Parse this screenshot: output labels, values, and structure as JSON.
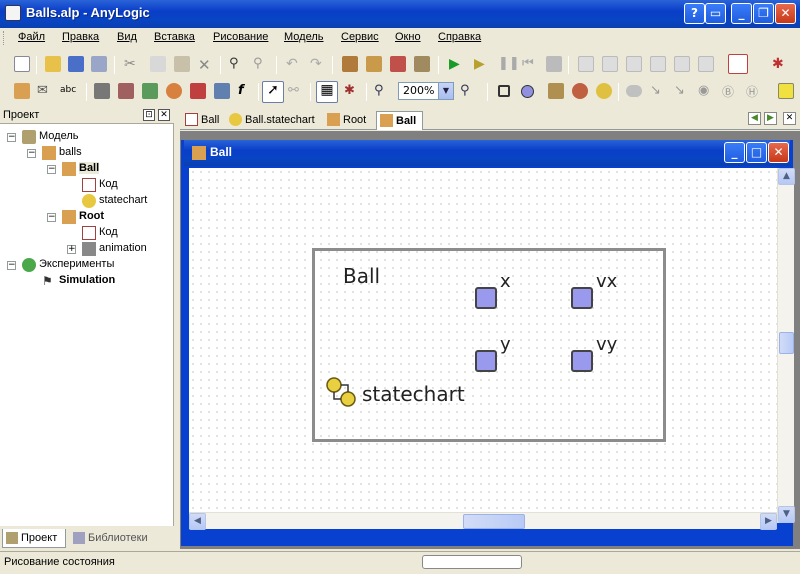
{
  "window": {
    "title": "Balls.alp - AnyLogic"
  },
  "menu": [
    "Файл",
    "Правка",
    "Вид",
    "Вставка",
    "Рисование",
    "Модель",
    "Сервис",
    "Окно",
    "Справка"
  ],
  "toolbar": {
    "zoom": "200%"
  },
  "project_panel": {
    "title": "Проект",
    "tree": [
      {
        "label": "Модель",
        "bold": false
      },
      {
        "label": "balls",
        "bold": false
      },
      {
        "label": "Ball",
        "bold": true
      },
      {
        "label": "Код",
        "bold": false
      },
      {
        "label": "statechart",
        "bold": false
      },
      {
        "label": "Root",
        "bold": true
      },
      {
        "label": "Код",
        "bold": false
      },
      {
        "label": "animation",
        "bold": false
      },
      {
        "label": "Эксперименты",
        "bold": false
      },
      {
        "label": "Simulation",
        "bold": true
      }
    ],
    "tabs": [
      "Проект",
      "Библиотеки"
    ]
  },
  "editor_tabs": [
    "Ball",
    "Ball.statechart",
    "Root",
    "Ball"
  ],
  "inner_window": {
    "title": "Ball"
  },
  "canvas": {
    "class_label": "Ball",
    "variables": [
      "x",
      "vx",
      "y",
      "vy"
    ],
    "statechart_label": "statechart"
  },
  "status": {
    "text": "Рисование состояния"
  }
}
